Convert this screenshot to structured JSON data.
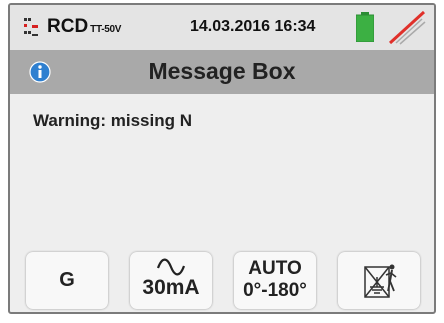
{
  "statusbar": {
    "mode": "RCD",
    "mode_sub": "TT-50V",
    "date": "14.03.2016",
    "time": "16:34",
    "battery_icon": "battery-icon",
    "probe_icon": "probe-disconnected-icon"
  },
  "titlebar": {
    "icon": "info-icon",
    "title": "Message Box"
  },
  "message": {
    "text": "Warning: missing N"
  },
  "buttons": [
    {
      "label": "G"
    },
    {
      "icon": "ac-wave-icon",
      "label": "30mA"
    },
    {
      "line1": "AUTO",
      "line2": "0°-180°"
    },
    {
      "icon": "ground-disabled-icon"
    }
  ],
  "colors": {
    "titlebar_bg": "#a9a9a9",
    "battery": "#3cb043",
    "info": "#2f80d0",
    "probe_cross": "#e0302a"
  }
}
